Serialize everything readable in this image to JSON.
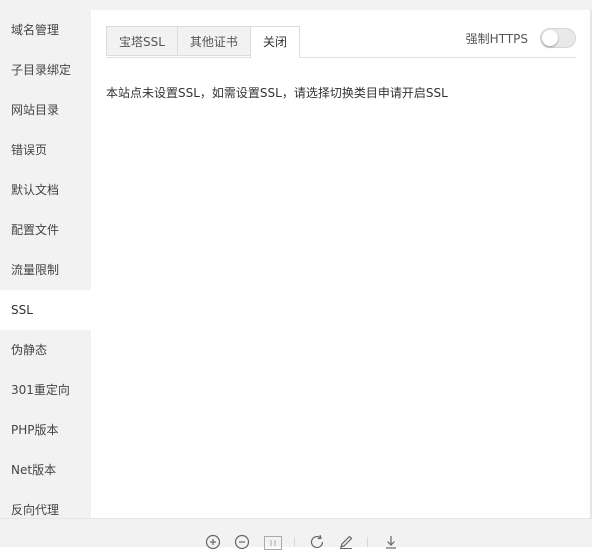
{
  "sidebar": {
    "items": [
      {
        "label": "域名管理"
      },
      {
        "label": "子目录绑定"
      },
      {
        "label": "网站目录"
      },
      {
        "label": "错误页"
      },
      {
        "label": "默认文档"
      },
      {
        "label": "配置文件"
      },
      {
        "label": "流量限制"
      },
      {
        "label": "SSL"
      },
      {
        "label": "伪静态"
      },
      {
        "label": "301重定向"
      },
      {
        "label": "PHP版本"
      },
      {
        "label": "Net版本"
      },
      {
        "label": "反向代理"
      }
    ],
    "active_label": "SSL"
  },
  "tabs": [
    {
      "label": "宝塔SSL"
    },
    {
      "label": "其他证书"
    },
    {
      "label": "关闭"
    }
  ],
  "active_tab": "关闭",
  "force_https": {
    "label": "强制HTTPS",
    "enabled": false
  },
  "message": "本站点未设置SSL，如需设置SSL，请选择切换类目申请开启SSL",
  "toolbar": {
    "icons": [
      "zoom-in-icon",
      "zoom-out-icon",
      "actual-size-icon",
      "rotate-icon",
      "edit-icon",
      "download-icon"
    ]
  },
  "colors": {
    "sidebar_bg": "#f2f2f2",
    "active_bg": "#ffffff",
    "toggle_off": "#e9e9e9"
  }
}
